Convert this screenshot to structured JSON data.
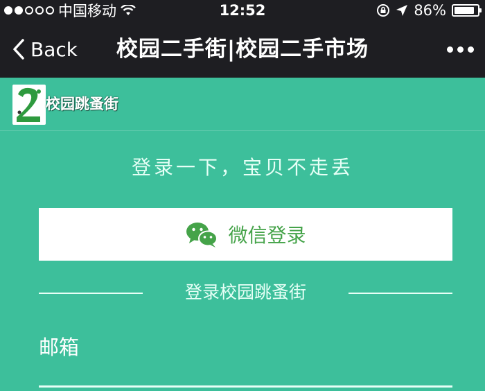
{
  "status_bar": {
    "carrier": "中国移动",
    "time": "12:52",
    "battery_percent": "86%",
    "battery_level": 0.86,
    "signal_dots_filled": 2,
    "signal_dots_total": 5
  },
  "nav": {
    "back_label": "Back",
    "title": "校园二手街|校园二手市场"
  },
  "brand": {
    "name": "校园跳蚤街"
  },
  "login": {
    "slogan": "登录一下，宝贝不走丢",
    "wechat_label": "微信登录",
    "divider_text": "登录校园跳蚤街",
    "email_label": "邮箱",
    "email_value": ""
  },
  "colors": {
    "background": "#3dbf9b",
    "nav_bar": "#1e1e22",
    "wechat_green": "#45a349"
  }
}
